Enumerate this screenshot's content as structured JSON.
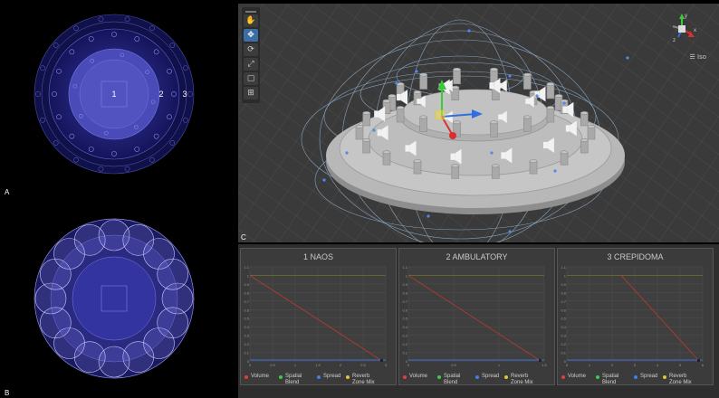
{
  "panel_labels": {
    "a": "A",
    "b": "B",
    "c": "C"
  },
  "diagram_a": {
    "ring1": "1",
    "ring2": "2",
    "ring3": "3"
  },
  "scene": {
    "iso_label": "Iso",
    "gizmo_axes": {
      "y": "y",
      "x": "x",
      "z": "z"
    },
    "tools": [
      {
        "name": "hand-tool",
        "glyph": "✋"
      },
      {
        "name": "move-tool",
        "glyph": "✥"
      },
      {
        "name": "rotate-tool",
        "glyph": "⟳"
      },
      {
        "name": "scale-tool",
        "glyph": "⤢"
      },
      {
        "name": "rect-tool",
        "glyph": "▢"
      },
      {
        "name": "transform-tool",
        "glyph": "⊞"
      }
    ]
  },
  "curves": [
    {
      "title": "1 NAOS",
      "x_ticks": [
        "0",
        "0.5",
        "1",
        "1.5",
        "2",
        "2.5",
        "3"
      ],
      "y_ticks": [
        "1.1",
        "1",
        "0.9",
        "0.8",
        "0.7",
        "0.6",
        "0.5",
        "0.4",
        "0.3",
        "0.2",
        "0.1",
        "0"
      ]
    },
    {
      "title": "2 AMBULATORY",
      "x_ticks": [
        "0",
        "0.5",
        "1",
        "1.5"
      ],
      "y_ticks": [
        "1.1",
        "1",
        "0.9",
        "0.8",
        "0.7",
        "0.6",
        "0.5",
        "0.4",
        "0.3",
        "0.2",
        "0.1",
        "0"
      ]
    },
    {
      "title": "3 CREPIDOMA",
      "x_ticks": [
        "0",
        "1",
        "2",
        "3",
        "4",
        "5",
        "6"
      ],
      "y_ticks": [
        "1.1",
        "1",
        "0.9",
        "0.8",
        "0.7",
        "0.6",
        "0.5",
        "0.4",
        "0.3",
        "0.2",
        "0.1",
        "0"
      ]
    }
  ],
  "legend": [
    {
      "label": "Volume",
      "color": "#e0403a"
    },
    {
      "label": "Spatial Blend",
      "color": "#41c84a"
    },
    {
      "label": "Spread",
      "color": "#3b82e6"
    },
    {
      "label": "Reverb Zone Mix",
      "color": "#e0c43a"
    }
  ],
  "colors": {
    "scene_bg": "#3a3a3a",
    "plan_blue": "#2a2a8a",
    "volume_line": "#b13a32",
    "spread_line": "#3b6fd4"
  }
}
